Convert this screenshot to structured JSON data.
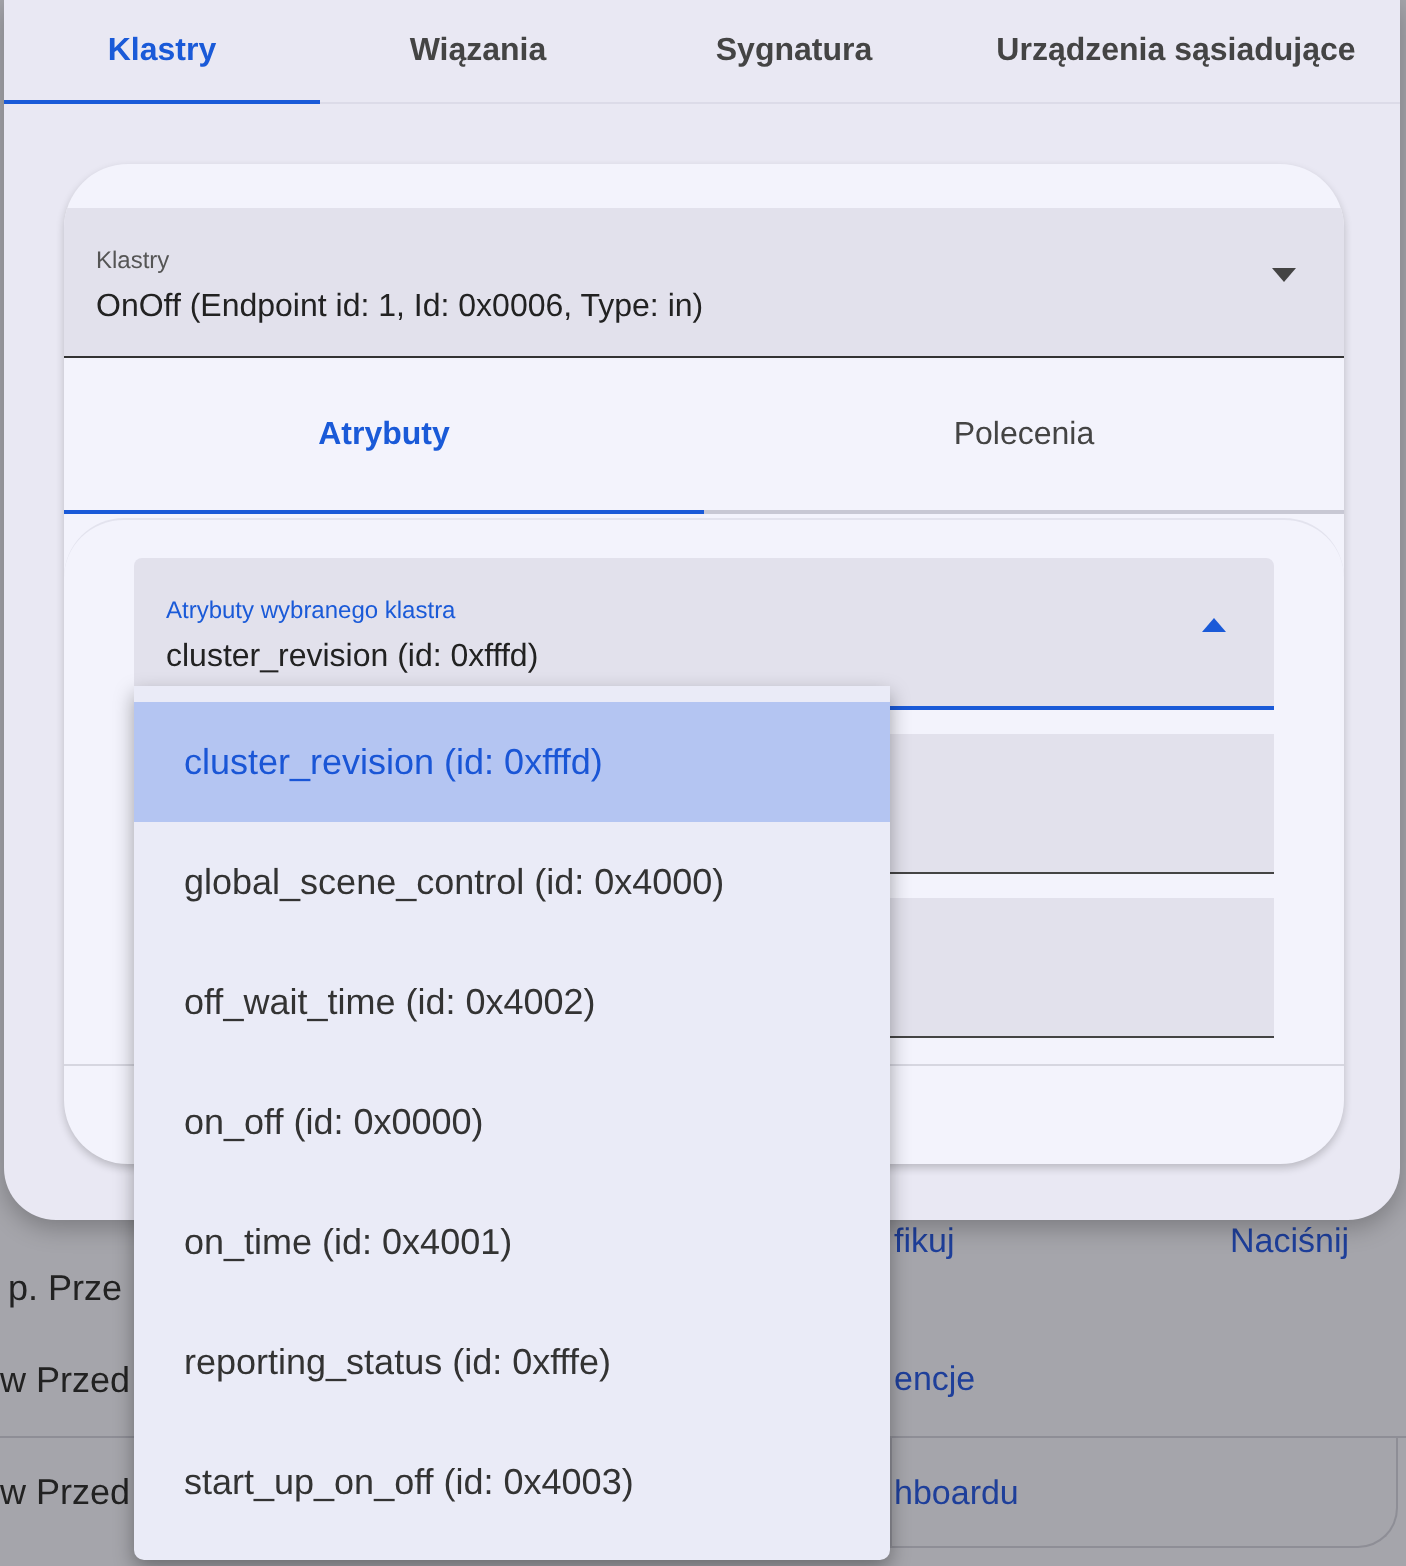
{
  "tabs": [
    {
      "label": "Klastry",
      "selected": true
    },
    {
      "label": "Wiązania",
      "selected": false
    },
    {
      "label": "Sygnatura",
      "selected": false
    },
    {
      "label": "Urządzenia sąsiadujące",
      "selected": false
    }
  ],
  "cluster_select": {
    "label": "Klastry",
    "value": "OnOff (Endpoint id: 1, Id: 0x0006, Type: in)",
    "expanded": false
  },
  "sub_tabs": [
    {
      "label": "Atrybuty",
      "selected": true
    },
    {
      "label": "Polecenia",
      "selected": false
    }
  ],
  "attribute_select": {
    "label": "Atrybuty wybranego klastra",
    "value": "cluster_revision (id: 0xfffd)",
    "expanded": true,
    "options": [
      {
        "label": "cluster_revision (id: 0xfffd)",
        "selected": true
      },
      {
        "label": "global_scene_control (id: 0x4000)",
        "selected": false
      },
      {
        "label": "off_wait_time (id: 0x4002)",
        "selected": false
      },
      {
        "label": "on_off (id: 0x0000)",
        "selected": false
      },
      {
        "label": "on_time (id: 0x4001)",
        "selected": false
      },
      {
        "label": "reporting_status (id: 0xfffe)",
        "selected": false
      },
      {
        "label": "start_up_on_off (id: 0x4003)",
        "selected": false
      }
    ]
  },
  "background": {
    "rows": [
      {
        "column_1": "p. Prze",
        "column_2": "fikuj",
        "column_3": "Naciśnij"
      },
      {
        "column_1": "w Przed",
        "column_2": "encje"
      },
      {
        "column_1": "w Przed",
        "column_2": "hboardu"
      }
    ]
  }
}
